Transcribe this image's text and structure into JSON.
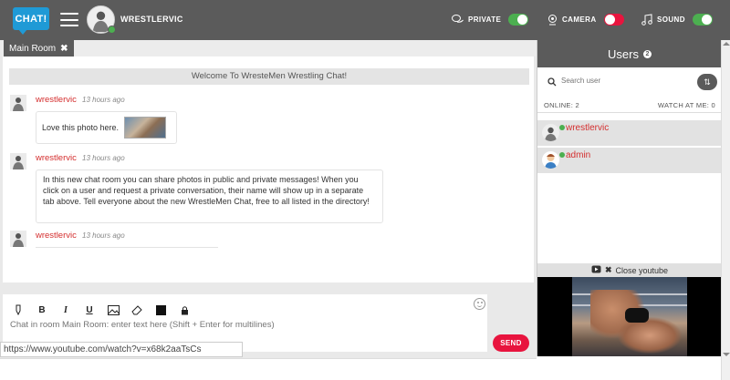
{
  "header": {
    "logo_text": "CHAT!",
    "username": "WRESTLERVIC",
    "toggles": [
      {
        "label": "PRIVATE",
        "icon": "chat-bubbles-icon",
        "state": "on",
        "color": "#4caf50"
      },
      {
        "label": "CAMERA",
        "icon": "webcam-icon",
        "state": "off",
        "color": "#e8143e"
      },
      {
        "label": "SOUND",
        "icon": "music-note-icon",
        "state": "on",
        "color": "#4caf50"
      }
    ]
  },
  "tabs": [
    {
      "label": "Main Room",
      "active": true
    }
  ],
  "chat": {
    "welcome": "Welcome To WresteMen Wrestling Chat!",
    "messages": [
      {
        "user": "wrestlervic",
        "time": "13 hours ago",
        "text": "Love this photo here.",
        "has_photo": true
      },
      {
        "user": "wrestlervic",
        "time": "13 hours ago",
        "text": "In this new chat room you can share photos in public and private messages! When you click on a user and request a private conversation, their name will show up in a separate tab above. Tell everyone about the new WrestleMen Chat, free to all listed in the directory!"
      },
      {
        "user": "wrestlervic",
        "time": "13 hours ago",
        "text": ""
      }
    ]
  },
  "composer": {
    "tools": [
      "pencil-icon",
      "bold-icon",
      "italic-icon",
      "underline-icon",
      "image-icon",
      "eraser-icon",
      "color-swatch",
      "lock-icon"
    ],
    "tool_labels": {
      "bold": "B",
      "italic": "I",
      "underline": "U"
    },
    "placeholder": "Chat in room Main Room: enter text here (Shift + Enter for multilines)",
    "send_label": "SEND",
    "send_color": "#e8143e"
  },
  "status_url": "https://www.youtube.com/watch?v=x68k2aaTsCs",
  "users_panel": {
    "title": "Users",
    "count": "2",
    "search_placeholder": "Search user",
    "online_label": "ONLINE: 2",
    "watch_label": "WATCH AT ME: 0",
    "users": [
      {
        "name": "wrestlervic",
        "status": "online",
        "selected": true
      },
      {
        "name": "admin",
        "status": "online",
        "selected": true
      }
    ]
  },
  "youtube": {
    "close_label": "Close youtube"
  },
  "colors": {
    "topbar": "#5b5b5b",
    "accent_red": "#e8143e",
    "username_red": "#d42e2e",
    "logo_blue": "#1f9ad6"
  }
}
